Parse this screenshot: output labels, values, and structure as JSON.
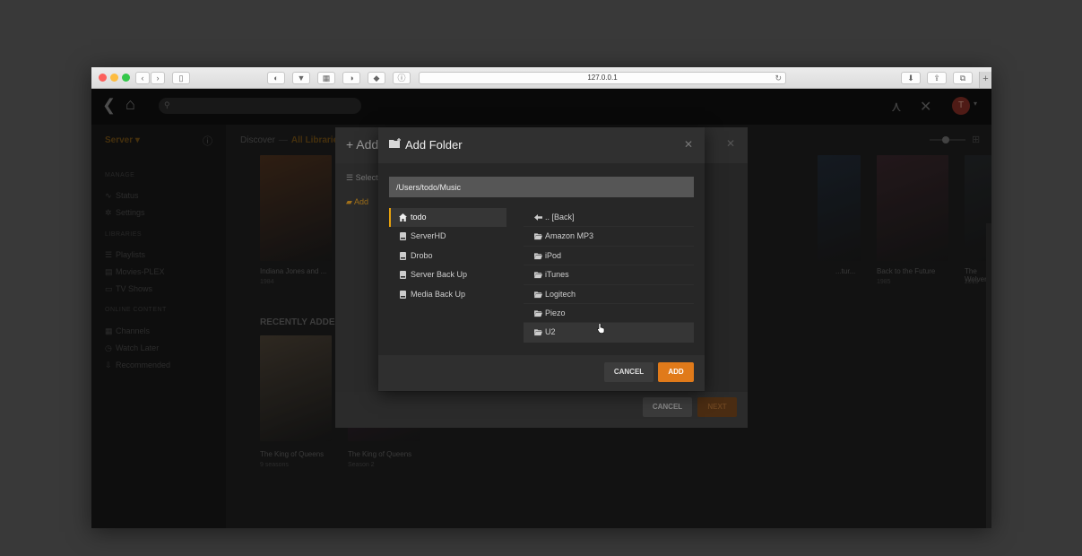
{
  "browser": {
    "url": "127.0.0.1"
  },
  "sidebar": {
    "server_label": "Server ▾",
    "sections": [
      {
        "heading": "MANAGE",
        "items": [
          "Status",
          "Settings"
        ]
      },
      {
        "heading": "LIBRARIES",
        "items": [
          "Playlists",
          "Movies-PLEX",
          "TV Shows"
        ]
      },
      {
        "heading": "ONLINE CONTENT",
        "items": [
          "Channels",
          "Watch Later",
          "Recommended"
        ]
      }
    ]
  },
  "main": {
    "breadcrumb_discover": "Discover",
    "breadcrumb_sep": "—",
    "breadcrumb_library": "All Libraries",
    "recently_added": "RECENTLY ADDED",
    "posters": [
      {
        "title": "Indiana Jones and ...",
        "sub": "1984",
        "color": "#6b3d1f"
      },
      {
        "title": "...tur...",
        "sub": "",
        "color": "#223246"
      },
      {
        "title": "Back to the Future",
        "sub": "1985",
        "color": "#4a2b33"
      },
      {
        "title": "The Wolverine",
        "sub": "2013",
        "color": "#2a2f33"
      },
      {
        "title": "The King of Queens",
        "sub": "9 seasons",
        "color": "#6a5a45"
      },
      {
        "title": "The King of Queens",
        "sub": "Season 2",
        "color": "#5a2a4a"
      }
    ]
  },
  "library_dialog": {
    "title": "Add",
    "steps": [
      "Select",
      "Add",
      "",
      ""
    ],
    "cancel_label": "CANCEL",
    "next_label": "NEXT"
  },
  "folder_dialog": {
    "title": "Add Folder",
    "path_value": "/Users/todo/Music",
    "locations": [
      {
        "label": "todo",
        "icon": "home-icon"
      },
      {
        "label": "ServerHD",
        "icon": "drive-icon"
      },
      {
        "label": "Drobo",
        "icon": "drive-icon"
      },
      {
        "label": "Server Back Up",
        "icon": "drive-icon"
      },
      {
        "label": "Media Back Up",
        "icon": "drive-icon"
      }
    ],
    "folders": [
      {
        "label": ".. [Back]",
        "icon": "back-arrow-icon"
      },
      {
        "label": "Amazon MP3",
        "icon": "folder-icon"
      },
      {
        "label": "iPod",
        "icon": "folder-icon"
      },
      {
        "label": "iTunes",
        "icon": "folder-icon"
      },
      {
        "label": "Logitech",
        "icon": "folder-icon"
      },
      {
        "label": "Piezo",
        "icon": "folder-icon"
      },
      {
        "label": "U2",
        "icon": "folder-icon"
      }
    ],
    "cancel_label": "CANCEL",
    "add_label": "ADD"
  },
  "colors": {
    "accent": "#e5a00d",
    "add_button": "#e07a1a"
  }
}
